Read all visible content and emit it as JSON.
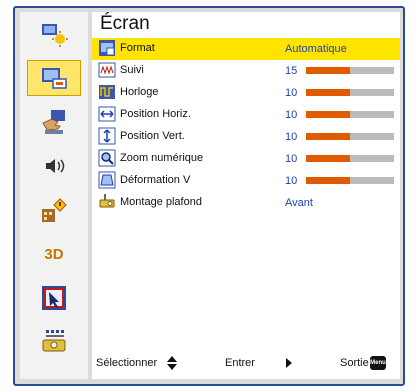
{
  "menu": {
    "title": "Écran",
    "items": [
      {
        "label": "Format",
        "value": "Automatique",
        "icon": "format-icon"
      },
      {
        "label": "Suivi",
        "value": "15",
        "level": 0.5,
        "icon": "tracking-icon"
      },
      {
        "label": "Horloge",
        "value": "10",
        "level": 0.5,
        "icon": "clock-icon"
      },
      {
        "label": "Position Horiz.",
        "value": "10",
        "level": 0.5,
        "icon": "hpos-icon"
      },
      {
        "label": "Position Vert.",
        "value": "10",
        "level": 0.5,
        "icon": "vpos-icon"
      },
      {
        "label": "Zoom numérique",
        "value": "10",
        "level": 0.5,
        "icon": "zoom-icon"
      },
      {
        "label": "Déformation V",
        "value": "10",
        "level": 0.5,
        "icon": "keystone-icon"
      },
      {
        "label": "Montage plafond",
        "value": "Avant",
        "icon": "ceiling-mount-icon"
      }
    ]
  },
  "sidebar": {
    "items": [
      {
        "icon": "picture-brightness-icon",
        "active": false
      },
      {
        "icon": "display-icon",
        "active": true
      },
      {
        "icon": "setup-hand-icon",
        "active": false
      },
      {
        "icon": "audio-icon",
        "active": false
      },
      {
        "icon": "options-icon",
        "active": false
      },
      {
        "icon": "3d-label",
        "text": "3D",
        "active": false
      },
      {
        "icon": "lamp-icon",
        "active": false
      },
      {
        "icon": "network-icon",
        "active": false
      }
    ]
  },
  "footer": {
    "select_label": "Sélectionner",
    "enter_label": "Entrer",
    "exit_label": "Sortie",
    "menu_key": "Menu"
  },
  "colors": {
    "accent_highlight": "#ffe400",
    "value_text": "#1f3fb0",
    "bar_fill": "#e05a00",
    "frame": "#2a4a9a"
  }
}
